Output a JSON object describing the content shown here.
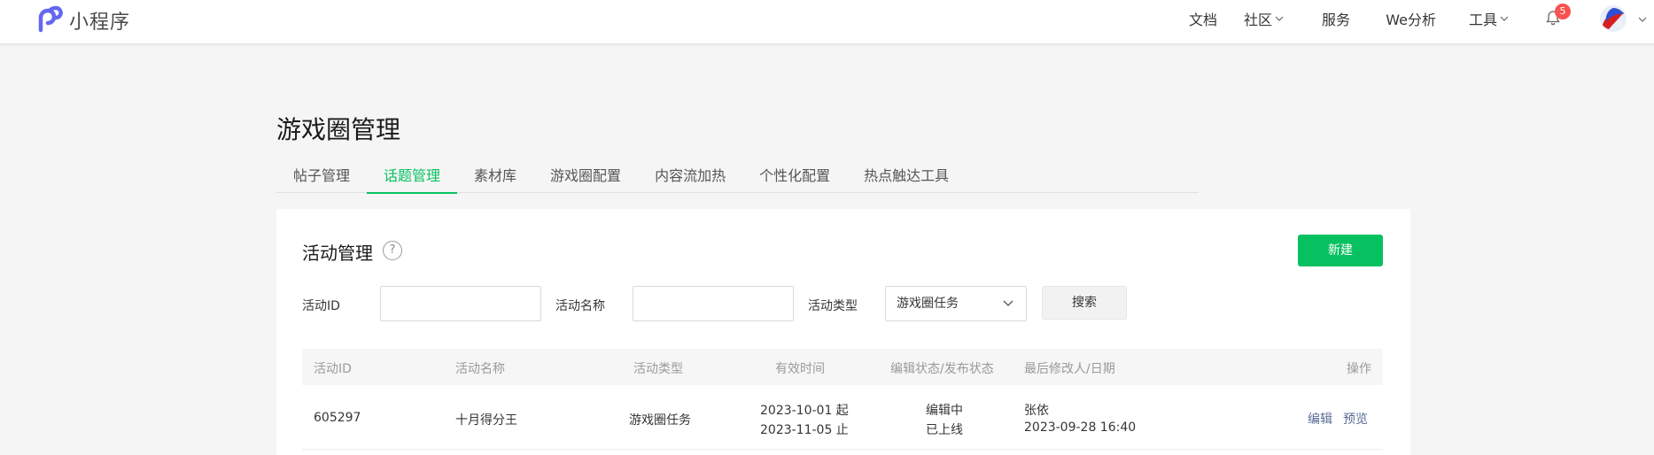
{
  "header": {
    "brand": "小程序",
    "nav": [
      {
        "label": "文档",
        "dropdown": false
      },
      {
        "label": "社区",
        "dropdown": true
      },
      {
        "label": "服务",
        "dropdown": false
      },
      {
        "label": "We分析",
        "dropdown": false
      },
      {
        "label": "工具",
        "dropdown": true
      }
    ],
    "notification_count": "5",
    "icons": [
      "logo-icon",
      "bell-icon",
      "avatar",
      "chevron-down-icon"
    ]
  },
  "page": {
    "title": "游戏圈管理",
    "tabs": [
      "帖子管理",
      "话题管理",
      "素材库",
      "游戏圈配置",
      "内容流加热",
      "个性化配置",
      "热点触达工具"
    ],
    "active_tab": "话题管理"
  },
  "card": {
    "title": "活动管理",
    "help": "?",
    "new_button": "新建",
    "filters": {
      "id_label": "活动ID",
      "id_value": "",
      "name_label": "活动名称",
      "name_value": "",
      "type_label": "活动类型",
      "type_value": "游戏圈任务",
      "search_button": "搜索"
    },
    "table": {
      "columns": [
        "活动ID",
        "活动名称",
        "活动类型",
        "有效时间",
        "编辑状态/发布状态",
        "最后修改人/日期",
        "操作"
      ],
      "rows": [
        {
          "id": "605297",
          "name": "十月得分王",
          "type": "游戏圈任务",
          "start": "2023-10-01 起",
          "end": "2023-11-05 止",
          "edit_status": "编辑中",
          "publish_status": "已上线",
          "modifier": "张依",
          "modified_at": "2023-09-28 16:40",
          "actions": [
            "编辑",
            "预览"
          ]
        }
      ]
    }
  },
  "colors": {
    "accent": "#07c160",
    "link": "#576b95",
    "badge": "#fa5151"
  }
}
